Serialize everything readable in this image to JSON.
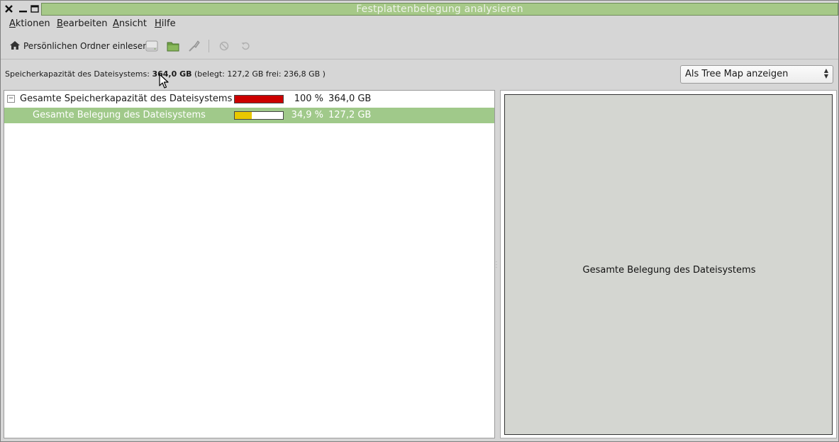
{
  "window": {
    "title": "Festplattenbelegung analysieren"
  },
  "menu": [
    {
      "first": "A",
      "rest": "ktionen"
    },
    {
      "first": "B",
      "rest": "earbeiten"
    },
    {
      "first": "A",
      "rest": "nsicht"
    },
    {
      "first": "H",
      "rest": "ilfe"
    }
  ],
  "toolbar": {
    "home_label": "Persönlichen Ordner einlesen",
    "icons": [
      "scan-filesystem-icon",
      "scan-folder-icon",
      "scan-remote-icon",
      "stop-icon",
      "refresh-icon"
    ]
  },
  "info": {
    "label": "Speicherkapazität des Dateisystems:",
    "capacity": "364,0 GB",
    "detail": "(belegt: 127,2 GB frei: 236,8 GB )"
  },
  "view_select": {
    "value": "Als Tree Map anzeigen"
  },
  "tree": {
    "rows": [
      {
        "name": "Gesamte Speicherkapazität des Dateisystems",
        "percent_text": "100 %",
        "size": "364,0 GB",
        "fraction": 1.0,
        "bar_color": "#cc0000",
        "selected": false,
        "expander": "−"
      },
      {
        "name": "Gesamte Belegung des Dateisystems",
        "percent_text": "34,9 %",
        "size": "127,2 GB",
        "fraction": 0.349,
        "bar_color": "#e8c800",
        "selected": true,
        "expander": ""
      }
    ]
  },
  "treemap": {
    "label": "Gesamte Belegung des Dateisystems"
  },
  "colors": {
    "selection": "#a0c98a",
    "titlebar": "#a6c988"
  }
}
